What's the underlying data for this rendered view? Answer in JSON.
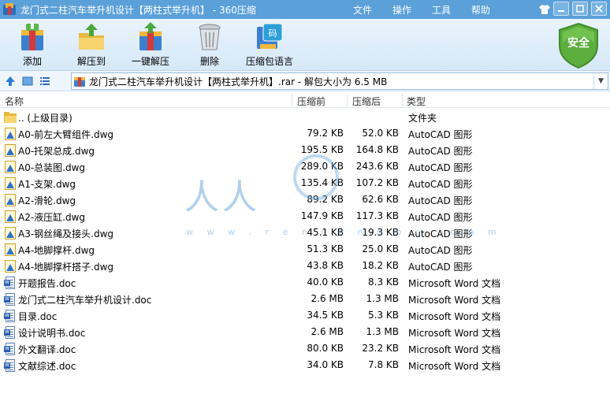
{
  "window": {
    "title": "龙门式二柱汽车举升机设计【两柱式举升机】 - 360压缩"
  },
  "menu": [
    "文件",
    "操作",
    "工具",
    "帮助"
  ],
  "toolbar": {
    "items": [
      {
        "label": "添加",
        "icon": "add-archive-icon"
      },
      {
        "label": "解压到",
        "icon": "extract-to-icon"
      },
      {
        "label": "一键解压",
        "icon": "one-click-extract-icon"
      },
      {
        "label": "删除",
        "icon": "trash-icon"
      },
      {
        "label": "压缩包语言",
        "icon": "archive-language-icon"
      }
    ],
    "safe_badge": "安全"
  },
  "address": {
    "path": "龙门式二柱汽车举升机设计【两柱式举升机】.rar - 解包大小为 6.5 MB"
  },
  "columns": {
    "name": "名称",
    "compressed": "压缩前",
    "original": "压缩后",
    "type": "类型"
  },
  "files": [
    {
      "name": ".. (上级目录)",
      "compressed": "",
      "original": "",
      "type": "文件夹",
      "icon": "folder"
    },
    {
      "name": "A0-前左大臂组件.dwg",
      "compressed": "79.2 KB",
      "original": "52.0 KB",
      "type": "AutoCAD 图形",
      "icon": "dwg"
    },
    {
      "name": "A0-托架总成.dwg",
      "compressed": "195.5 KB",
      "original": "164.8 KB",
      "type": "AutoCAD 图形",
      "icon": "dwg"
    },
    {
      "name": "A0-总装图.dwg",
      "compressed": "289.0 KB",
      "original": "243.6 KB",
      "type": "AutoCAD 图形",
      "icon": "dwg"
    },
    {
      "name": "A1-支架.dwg",
      "compressed": "135.4 KB",
      "original": "107.2 KB",
      "type": "AutoCAD 图形",
      "icon": "dwg"
    },
    {
      "name": "A2-滑轮.dwg",
      "compressed": "89.2 KB",
      "original": "62.6 KB",
      "type": "AutoCAD 图形",
      "icon": "dwg"
    },
    {
      "name": "A2-液压缸.dwg",
      "compressed": "147.9 KB",
      "original": "117.3 KB",
      "type": "AutoCAD 图形",
      "icon": "dwg"
    },
    {
      "name": "A3-钢丝绳及接头.dwg",
      "compressed": "45.1 KB",
      "original": "19.3 KB",
      "type": "AutoCAD 图形",
      "icon": "dwg"
    },
    {
      "name": "A4-地脚撑杆.dwg",
      "compressed": "51.3 KB",
      "original": "25.0 KB",
      "type": "AutoCAD 图形",
      "icon": "dwg"
    },
    {
      "name": "A4-地脚撑杆搭子.dwg",
      "compressed": "43.8 KB",
      "original": "18.2 KB",
      "type": "AutoCAD 图形",
      "icon": "dwg"
    },
    {
      "name": "开题报告.doc",
      "compressed": "40.0 KB",
      "original": "8.3 KB",
      "type": "Microsoft Word 文档",
      "icon": "doc"
    },
    {
      "name": "龙门式二柱汽车举升机设计.doc",
      "compressed": "2.6 MB",
      "original": "1.3 MB",
      "type": "Microsoft Word 文档",
      "icon": "doc"
    },
    {
      "name": "目录.doc",
      "compressed": "34.5 KB",
      "original": "5.3 KB",
      "type": "Microsoft Word 文档",
      "icon": "doc"
    },
    {
      "name": "设计说明书.doc",
      "compressed": "2.6 MB",
      "original": "1.3 MB",
      "type": "Microsoft Word 文档",
      "icon": "doc"
    },
    {
      "name": "外文翻译.doc",
      "compressed": "80.0 KB",
      "original": "23.2 KB",
      "type": "Microsoft Word 文档",
      "icon": "doc"
    },
    {
      "name": "文献综述.doc",
      "compressed": "34.0 KB",
      "original": "7.8 KB",
      "type": "Microsoft Word 文档",
      "icon": "doc"
    }
  ],
  "watermark": {
    "text": "人人",
    "url": "w w w . r e n r e n d o c . c o m"
  },
  "colors": {
    "titlebar": "#5ba0d8",
    "toolbar": "#e0edf9",
    "safe_badge": "#5cae3d"
  }
}
